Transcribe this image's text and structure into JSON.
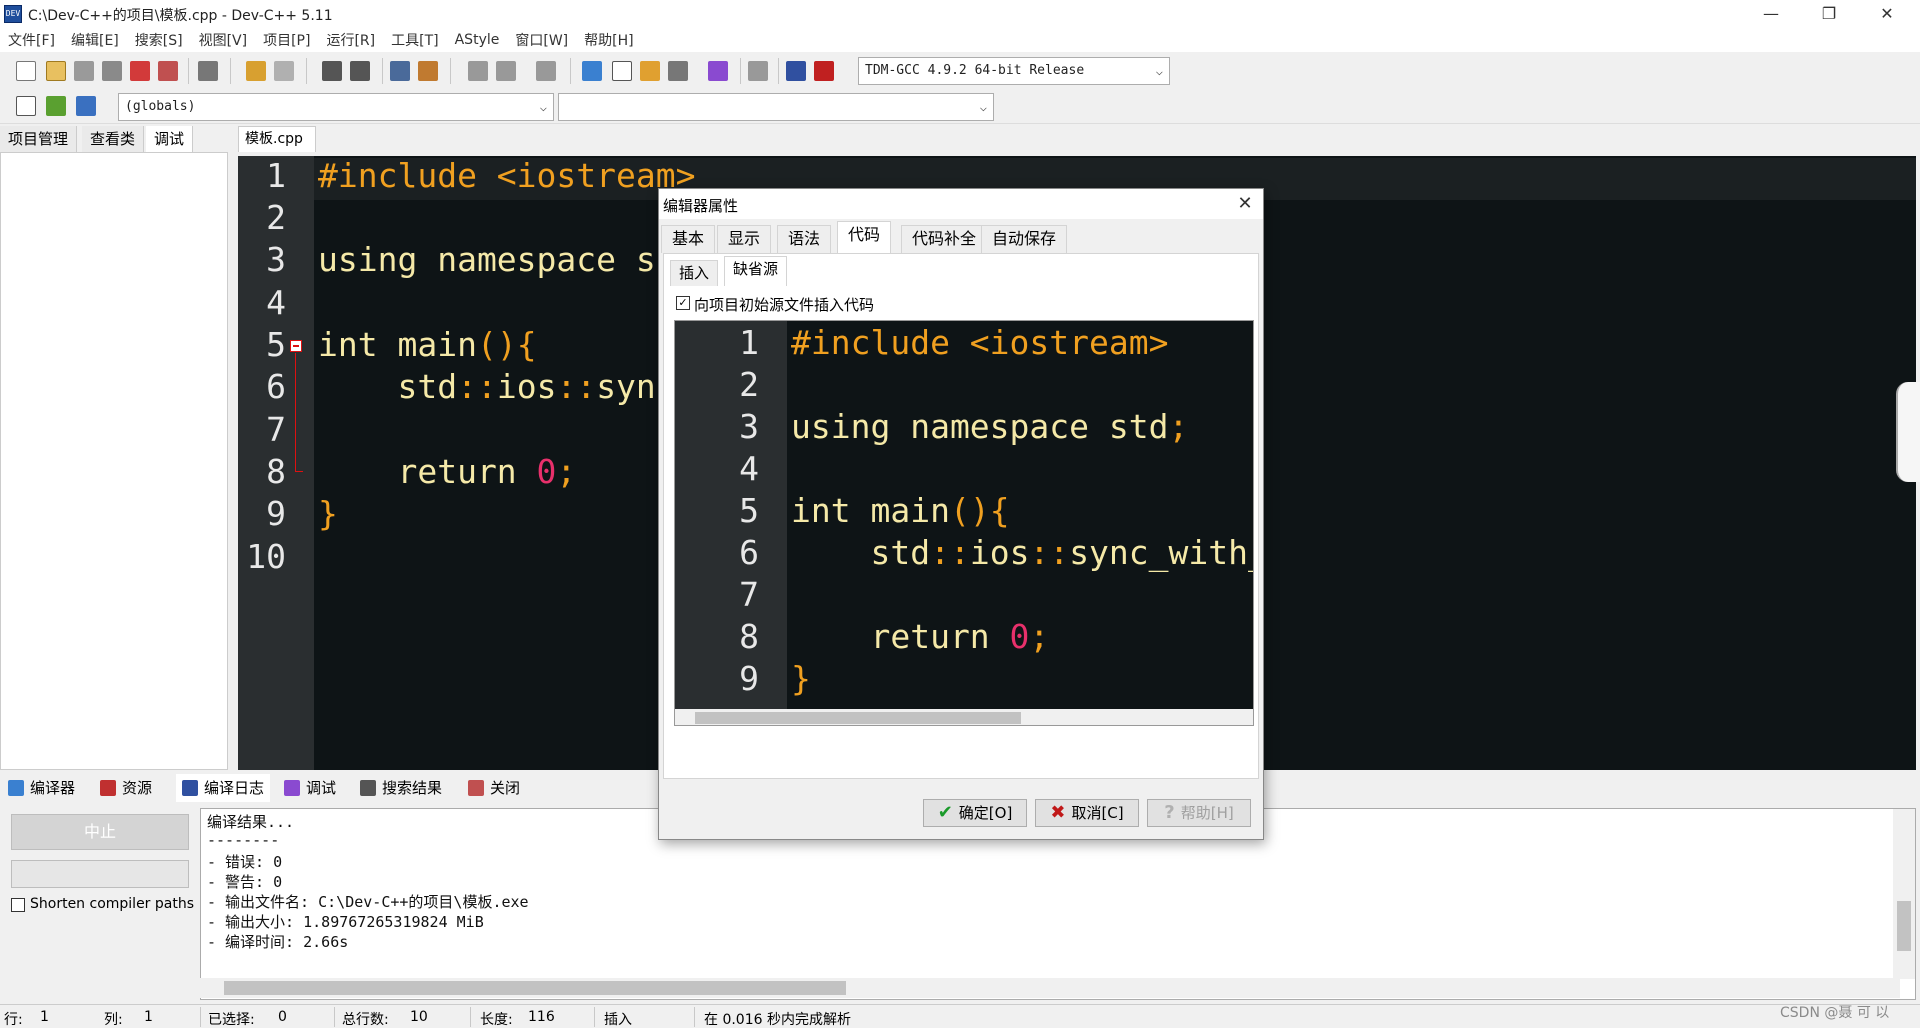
{
  "window": {
    "title": "C:\\Dev-C++的项目\\模板.cpp - Dev-C++ 5.11",
    "app_icon": "DEV"
  },
  "menu": [
    "文件[F]",
    "编辑[E]",
    "搜索[S]",
    "视图[V]",
    "项目[P]",
    "运行[R]",
    "工具[T]",
    "AStyle",
    "窗口[W]",
    "帮助[H]"
  ],
  "toolbar": {
    "compiler_select": "TDM-GCC 4.9.2 64-bit Release",
    "scope_select": "(globals)",
    "symbol_select": ""
  },
  "left_tabs": [
    "项目管理",
    "查看类",
    "调试"
  ],
  "file_tab": "模板.cpp",
  "editor": {
    "line_numbers": [
      "1",
      "2",
      "3",
      "4",
      "5",
      "6",
      "7",
      "8",
      "9",
      "10"
    ],
    "lines": {
      "l1_pp": "#include <iostream>",
      "l3_a": "using namespace s",
      "l5_a": "int main",
      "l5_b": "(){",
      "l6_a": "    std",
      "l6_b": "::",
      "l6_c": "ios",
      "l6_d": "::",
      "l6_e": "syn",
      "l8_a": "    return ",
      "l8_b": "0",
      "l8_c": ";",
      "l9": "}"
    }
  },
  "bottom_tabs": [
    "编译器",
    "资源",
    "编译日志",
    "调试",
    "搜索结果",
    "关闭"
  ],
  "bottom_left": {
    "stop_label": "中止",
    "shorten_label": "Shorten compiler paths"
  },
  "log": [
    "编译结果...",
    "--------",
    "- 错误: 0",
    "- 警告: 0",
    "- 输出文件名: C:\\Dev-C++的项目\\模板.exe",
    "- 输出大小: 1.89767265319824 MiB",
    "- 编译时间: 2.66s"
  ],
  "status": {
    "row_label": "行:",
    "row_value": "1",
    "col_label": "列:",
    "col_value": "1",
    "sel_label": "已选择:",
    "sel_value": "0",
    "lines_label": "总行数:",
    "lines_value": "10",
    "len_label": "长度:",
    "len_value": "116",
    "mode": "插入",
    "parse": "在 0.016 秒内完成解析"
  },
  "watermark": "CSDN @聂 可 以",
  "dialog": {
    "title": "编辑器属性",
    "close": "✕",
    "tabs": [
      "基本",
      "显示",
      "语法",
      "代码",
      "代码补全",
      "自动保存"
    ],
    "subtabs": [
      "插入",
      "缺省源"
    ],
    "checkbox_label": "向项目初始源文件插入代码",
    "checkbox_checked": "✓",
    "preview": {
      "line_numbers": [
        "1",
        "2",
        "3",
        "4",
        "5",
        "6",
        "7",
        "8",
        "9"
      ],
      "l1": "#include <iostream>",
      "l3_a": "using namespace std",
      "l3_b": ";",
      "l5_a": "int main",
      "l5_b": "(){",
      "l6_a": "    std",
      "l6_b": "::",
      "l6_c": "ios",
      "l6_d": "::",
      "l6_e": "sync_with_",
      "l8_a": "    return ",
      "l8_b": "0",
      "l8_c": ";",
      "l9": "}"
    },
    "ok_label": "确定[O]",
    "cancel_label": "取消[C]",
    "help_label": "帮助[H]"
  }
}
